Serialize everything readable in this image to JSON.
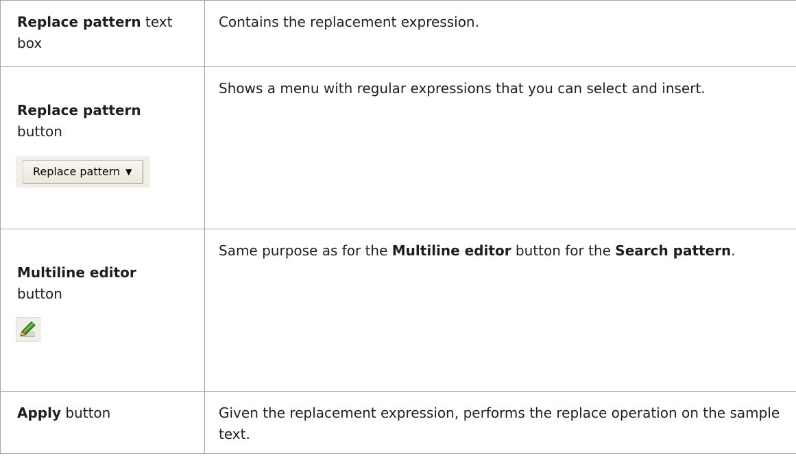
{
  "rows": [
    {
      "name_bold": "Replace pattern",
      "name_rest": " text box",
      "description": "Contains the replacement expression."
    },
    {
      "name_bold": "Replace pattern",
      "name_rest": "button",
      "image_button_label": "Replace pattern",
      "image_button_icon": "chevron-down-icon",
      "description": "Shows a menu with regular expressions that you can select and insert."
    },
    {
      "name_bold": "Multiline editor",
      "name_rest": "button",
      "image_icon": "pencil-icon",
      "description_part1": "Same purpose as for the ",
      "description_bold1": "Multiline editor",
      "description_part2": " button for the ",
      "description_bold2": "Search pattern",
      "description_part3": "."
    },
    {
      "name_bold": "Apply",
      "name_rest": " button",
      "description": "Given the replacement expression, performs the replace operation on the sample text."
    }
  ],
  "colors": {
    "border": "#a3a3a3",
    "button_face": "#f0efe7",
    "pencil_green": "#3f9a2a"
  }
}
